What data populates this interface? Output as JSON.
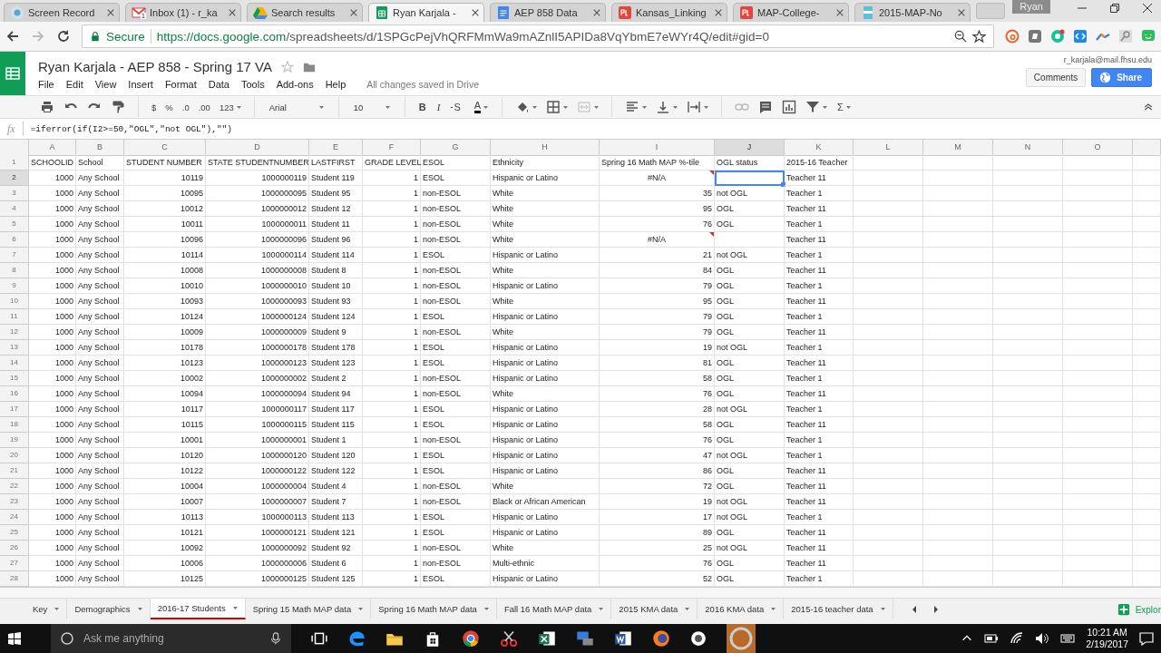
{
  "browser": {
    "tabs": [
      {
        "title": "Screen Record",
        "kind": "recorder",
        "selected": false
      },
      {
        "title": "Inbox (1) - r_ka",
        "kind": "mail",
        "badge": "1",
        "selected": false
      },
      {
        "title": "Search results",
        "kind": "drive",
        "selected": false
      },
      {
        "title": "Ryan Karjala -",
        "kind": "sheets",
        "selected": true
      },
      {
        "title": "AEP 858 Data",
        "kind": "docs",
        "selected": false
      },
      {
        "title": "Kansas_Linking",
        "kind": "pdf",
        "selected": false
      },
      {
        "title": "MAP-College-",
        "kind": "pdf",
        "selected": false
      },
      {
        "title": "2015-MAP-No",
        "kind": "file",
        "selected": false
      }
    ],
    "profile": "Ryan",
    "secure_label": "Secure",
    "url_host": "https://docs.google.com",
    "url_path": "/spreadsheets/d/1SPGcPejVhQRFMmWa9mAZnlI5APIDa8VqYbmE7eWYr4Q/edit#gid=0"
  },
  "doc": {
    "title": "Ryan Karjala - AEP 858 - Spring 17 VA",
    "menu": [
      "File",
      "Edit",
      "View",
      "Insert",
      "Format",
      "Data",
      "Tools",
      "Add-ons",
      "Help"
    ],
    "save_status": "All changes saved in Drive",
    "account": "r_karjala@mail.fhsu.edu",
    "comments_button": "Comments",
    "share_button": "Share"
  },
  "toolbar": {
    "items": [
      {
        "kind": "print",
        "has_menu": false
      },
      {
        "kind": "undo",
        "has_menu": false
      },
      {
        "kind": "redo",
        "has_menu": false
      },
      {
        "kind": "paint",
        "has_menu": false
      },
      {
        "kind": "sep"
      },
      {
        "kind": "text",
        "label": "$",
        "has_menu": false
      },
      {
        "kind": "text",
        "label": "%",
        "has_menu": false
      },
      {
        "kind": "text",
        "label": ".0",
        "has_menu": false
      },
      {
        "kind": "text",
        "label": ".00",
        "has_menu": false
      },
      {
        "kind": "text",
        "label": "123",
        "has_menu": true
      },
      {
        "kind": "sep"
      },
      {
        "kind": "dropdown",
        "label": "Arial"
      },
      {
        "kind": "sep"
      },
      {
        "kind": "dropdown",
        "label": "10"
      },
      {
        "kind": "sep"
      },
      {
        "kind": "bold",
        "label": "B",
        "has_menu": false
      },
      {
        "kind": "italic",
        "label": "I",
        "has_menu": false
      },
      {
        "kind": "strike",
        "label": "S",
        "has_menu": false
      },
      {
        "kind": "color",
        "label": "A",
        "has_menu": true
      },
      {
        "kind": "sep"
      },
      {
        "kind": "fill",
        "has_menu": true
      },
      {
        "kind": "borders",
        "has_menu": true
      },
      {
        "kind": "merge",
        "has_menu": true
      },
      {
        "kind": "sep"
      },
      {
        "kind": "align",
        "has_menu": true
      },
      {
        "kind": "valign",
        "has_menu": true
      },
      {
        "kind": "wrap",
        "has_menu": true
      },
      {
        "kind": "sep"
      },
      {
        "kind": "link",
        "has_menu": false
      },
      {
        "kind": "comment",
        "has_menu": false
      },
      {
        "kind": "chart",
        "has_menu": false
      },
      {
        "kind": "filter",
        "has_menu": true
      },
      {
        "kind": "plain",
        "label": "Σ",
        "has_menu": true
      }
    ]
  },
  "formula_bar": {
    "label": "fx",
    "formula": "=iferror(if(I2>=50,\"OGL\",\"not OGL\"),\"\")"
  },
  "sheet": {
    "columns": [
      {
        "letter": "A",
        "selected": false
      },
      {
        "letter": "B",
        "selected": false
      },
      {
        "letter": "C",
        "selected": false
      },
      {
        "letter": "D",
        "selected": false
      },
      {
        "letter": "E",
        "selected": false
      },
      {
        "letter": "F",
        "selected": false
      },
      {
        "letter": "G",
        "selected": false
      },
      {
        "letter": "H",
        "selected": false
      },
      {
        "letter": "I",
        "selected": false
      },
      {
        "letter": "J",
        "selected": true
      },
      {
        "letter": "K",
        "selected": false
      },
      {
        "letter": "L",
        "selected": false
      },
      {
        "letter": "M",
        "selected": false
      },
      {
        "letter": "N",
        "selected": false
      },
      {
        "letter": "O",
        "selected": false
      }
    ],
    "header_row": {
      "number": "1",
      "cells": [
        "SCHOOLID",
        "School",
        "STUDENT NUMBER",
        "STATE STUDENTNUMBER",
        "LASTFIRST",
        "GRADE LEVEL",
        "ESOL",
        "Ethnicity",
        "Spring 16 Math MAP %-tile",
        "OGL status",
        "2015-16 Teacher"
      ]
    },
    "rows": [
      {
        "number": "2",
        "selected": true,
        "error": true,
        "cells": [
          "1000",
          "Any School",
          "10119",
          "1000000119",
          "Student 119",
          "1",
          "ESOL",
          "Hispanic or Latino",
          "#N/A",
          null,
          "Teacher 11"
        ]
      },
      {
        "number": "3",
        "selected": false,
        "error": false,
        "cells": [
          "1000",
          "Any School",
          "10095",
          "1000000095",
          "Student 95",
          "1",
          "non-ESOL",
          "White",
          "35",
          "not OGL",
          "Teacher 1"
        ]
      },
      {
        "number": "4",
        "selected": false,
        "error": false,
        "cells": [
          "1000",
          "Any School",
          "10012",
          "1000000012",
          "Student 12",
          "1",
          "non-ESOL",
          "White",
          "95",
          "OGL",
          "Teacher 11"
        ]
      },
      {
        "number": "5",
        "selected": false,
        "error": false,
        "cells": [
          "1000",
          "Any School",
          "10011",
          "1000000011",
          "Student 11",
          "1",
          "non-ESOL",
          "White",
          "76",
          "OGL",
          "Teacher 1"
        ]
      },
      {
        "number": "6",
        "selected": false,
        "error": true,
        "cells": [
          "1000",
          "Any School",
          "10096",
          "1000000096",
          "Student 96",
          "1",
          "non-ESOL",
          "White",
          "#N/A",
          null,
          "Teacher 11"
        ]
      },
      {
        "number": "7",
        "selected": false,
        "error": false,
        "cells": [
          "1000",
          "Any School",
          "10114",
          "1000000114",
          "Student 114",
          "1",
          "ESOL",
          "Hispanic or Latino",
          "21",
          "not OGL",
          "Teacher 1"
        ]
      },
      {
        "number": "8",
        "selected": false,
        "error": false,
        "cells": [
          "1000",
          "Any School",
          "10008",
          "1000000008",
          "Student 8",
          "1",
          "non-ESOL",
          "White",
          "84",
          "OGL",
          "Teacher 11"
        ]
      },
      {
        "number": "9",
        "selected": false,
        "error": false,
        "cells": [
          "1000",
          "Any School",
          "10010",
          "1000000010",
          "Student 10",
          "1",
          "non-ESOL",
          "Hispanic or Latino",
          "79",
          "OGL",
          "Teacher 1"
        ]
      },
      {
        "number": "10",
        "selected": false,
        "error": false,
        "cells": [
          "1000",
          "Any School",
          "10093",
          "1000000093",
          "Student 93",
          "1",
          "non-ESOL",
          "White",
          "95",
          "OGL",
          "Teacher 11"
        ]
      },
      {
        "number": "11",
        "selected": false,
        "error": false,
        "cells": [
          "1000",
          "Any School",
          "10124",
          "1000000124",
          "Student 124",
          "1",
          "ESOL",
          "Hispanic or Latino",
          "79",
          "OGL",
          "Teacher 1"
        ]
      },
      {
        "number": "12",
        "selected": false,
        "error": false,
        "cells": [
          "1000",
          "Any School",
          "10009",
          "1000000009",
          "Student 9",
          "1",
          "non-ESOL",
          "White",
          "79",
          "OGL",
          "Teacher 11"
        ]
      },
      {
        "number": "13",
        "selected": false,
        "error": false,
        "cells": [
          "1000",
          "Any School",
          "10178",
          "1000000178",
          "Student 178",
          "1",
          "ESOL",
          "Hispanic or Latino",
          "19",
          "not OGL",
          "Teacher 1"
        ]
      },
      {
        "number": "14",
        "selected": false,
        "error": false,
        "cells": [
          "1000",
          "Any School",
          "10123",
          "1000000123",
          "Student 123",
          "1",
          "ESOL",
          "Hispanic or Latino",
          "81",
          "OGL",
          "Teacher 11"
        ]
      },
      {
        "number": "15",
        "selected": false,
        "error": false,
        "cells": [
          "1000",
          "Any School",
          "10002",
          "1000000002",
          "Student 2",
          "1",
          "non-ESOL",
          "Hispanic or Latino",
          "58",
          "OGL",
          "Teacher 1"
        ]
      },
      {
        "number": "16",
        "selected": false,
        "error": false,
        "cells": [
          "1000",
          "Any School",
          "10094",
          "1000000094",
          "Student 94",
          "1",
          "non-ESOL",
          "White",
          "76",
          "OGL",
          "Teacher 11"
        ]
      },
      {
        "number": "17",
        "selected": false,
        "error": false,
        "cells": [
          "1000",
          "Any School",
          "10117",
          "1000000117",
          "Student 117",
          "1",
          "ESOL",
          "Hispanic or Latino",
          "28",
          "not OGL",
          "Teacher 1"
        ]
      },
      {
        "number": "18",
        "selected": false,
        "error": false,
        "cells": [
          "1000",
          "Any School",
          "10115",
          "1000000115",
          "Student 115",
          "1",
          "ESOL",
          "Hispanic or Latino",
          "58",
          "OGL",
          "Teacher 11"
        ]
      },
      {
        "number": "19",
        "selected": false,
        "error": false,
        "cells": [
          "1000",
          "Any School",
          "10001",
          "1000000001",
          "Student 1",
          "1",
          "non-ESOL",
          "Hispanic or Latino",
          "76",
          "OGL",
          "Teacher 1"
        ]
      },
      {
        "number": "20",
        "selected": false,
        "error": false,
        "cells": [
          "1000",
          "Any School",
          "10120",
          "1000000120",
          "Student 120",
          "1",
          "ESOL",
          "Hispanic or Latino",
          "47",
          "not OGL",
          "Teacher 1"
        ]
      },
      {
        "number": "21",
        "selected": false,
        "error": false,
        "cells": [
          "1000",
          "Any School",
          "10122",
          "1000000122",
          "Student 122",
          "1",
          "ESOL",
          "Hispanic or Latino",
          "86",
          "OGL",
          "Teacher 11"
        ]
      },
      {
        "number": "22",
        "selected": false,
        "error": false,
        "cells": [
          "1000",
          "Any School",
          "10004",
          "1000000004",
          "Student 4",
          "1",
          "non-ESOL",
          "White",
          "72",
          "OGL",
          "Teacher 11"
        ]
      },
      {
        "number": "23",
        "selected": false,
        "error": false,
        "cells": [
          "1000",
          "Any School",
          "10007",
          "1000000007",
          "Student 7",
          "1",
          "non-ESOL",
          "Black or African American",
          "19",
          "not OGL",
          "Teacher 11"
        ]
      },
      {
        "number": "24",
        "selected": false,
        "error": false,
        "cells": [
          "1000",
          "Any School",
          "10113",
          "1000000113",
          "Student 113",
          "1",
          "ESOL",
          "Hispanic or Latino",
          "17",
          "not OGL",
          "Teacher 1"
        ]
      },
      {
        "number": "25",
        "selected": false,
        "error": false,
        "cells": [
          "1000",
          "Any School",
          "10121",
          "1000000121",
          "Student 121",
          "1",
          "ESOL",
          "Hispanic or Latino",
          "89",
          "OGL",
          "Teacher 11"
        ]
      },
      {
        "number": "26",
        "selected": false,
        "error": false,
        "cells": [
          "1000",
          "Any School",
          "10092",
          "1000000092",
          "Student 92",
          "1",
          "non-ESOL",
          "White",
          "25",
          "not OGL",
          "Teacher 11"
        ]
      },
      {
        "number": "27",
        "selected": false,
        "error": false,
        "cells": [
          "1000",
          "Any School",
          "10006",
          "1000000006",
          "Student 6",
          "1",
          "non-ESOL",
          "Multi-ethnic",
          "76",
          "OGL",
          "Teacher 11"
        ]
      },
      {
        "number": "28",
        "selected": false,
        "error": false,
        "cells": [
          "1000",
          "Any School",
          "10125",
          "1000000125",
          "Student 125",
          "1",
          "ESOL",
          "Hispanic or Latino",
          "52",
          "OGL",
          "Teacher 1"
        ]
      }
    ]
  },
  "sheet_tabs": [
    {
      "label": "Key",
      "selected": false
    },
    {
      "label": "Demographics",
      "selected": false
    },
    {
      "label": "2016-17 Students",
      "selected": true
    },
    {
      "label": "Spring 15 Math MAP data",
      "selected": false
    },
    {
      "label": "Spring 16 Math MAP data",
      "selected": false
    },
    {
      "label": "Fall 16 Math MAP data",
      "selected": false
    },
    {
      "label": "2015 KMA data",
      "selected": false
    },
    {
      "label": "2016 KMA data",
      "selected": false
    },
    {
      "label": "2015-16  teacher data",
      "selected": false
    }
  ],
  "explore_button": "Explor",
  "taskbar": {
    "search_placeholder": "Ask me anything",
    "time": "10:21 AM",
    "date": "2/19/2017"
  }
}
